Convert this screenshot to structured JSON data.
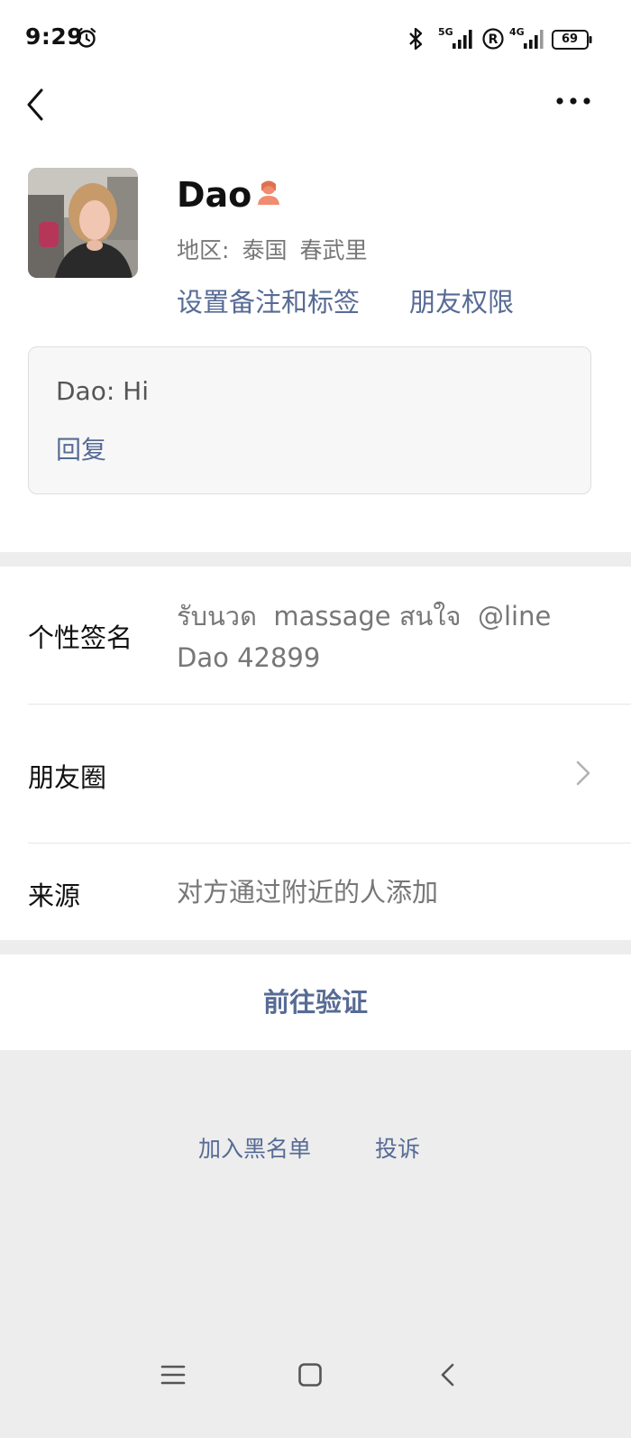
{
  "status_bar": {
    "time": "9:29",
    "signal1_label": "5G",
    "signal2_label": "4G",
    "battery": "69"
  },
  "nav": {
    "back_icon": "back-chevron-icon",
    "more_icon": "more-dots-icon"
  },
  "profile": {
    "name": "Dao",
    "gender_icon": "female-user-icon",
    "region_label": "地区:",
    "region_country": "泰国",
    "region_city": "春武里",
    "set_remark_label": "设置备注和标签",
    "friend_perm_label": "朋友权限"
  },
  "greeting": {
    "message": "Dao: Hi",
    "reply_label": "回复"
  },
  "info": {
    "signature_label": "个性签名",
    "signature_line1": "รับนวด  massage สนใจ  @line",
    "signature_line2": "Dao 42899",
    "moments_label": "朋友圈",
    "source_label": "来源",
    "source_value": "对方通过附近的人添加"
  },
  "actions": {
    "verify_label": "前往验证",
    "blacklist_label": "加入黑名单",
    "report_label": "投诉"
  },
  "colors": {
    "link": "#576b95",
    "background": "#ededed",
    "card": "#ffffff",
    "gender_icon": "#f08c6f"
  }
}
